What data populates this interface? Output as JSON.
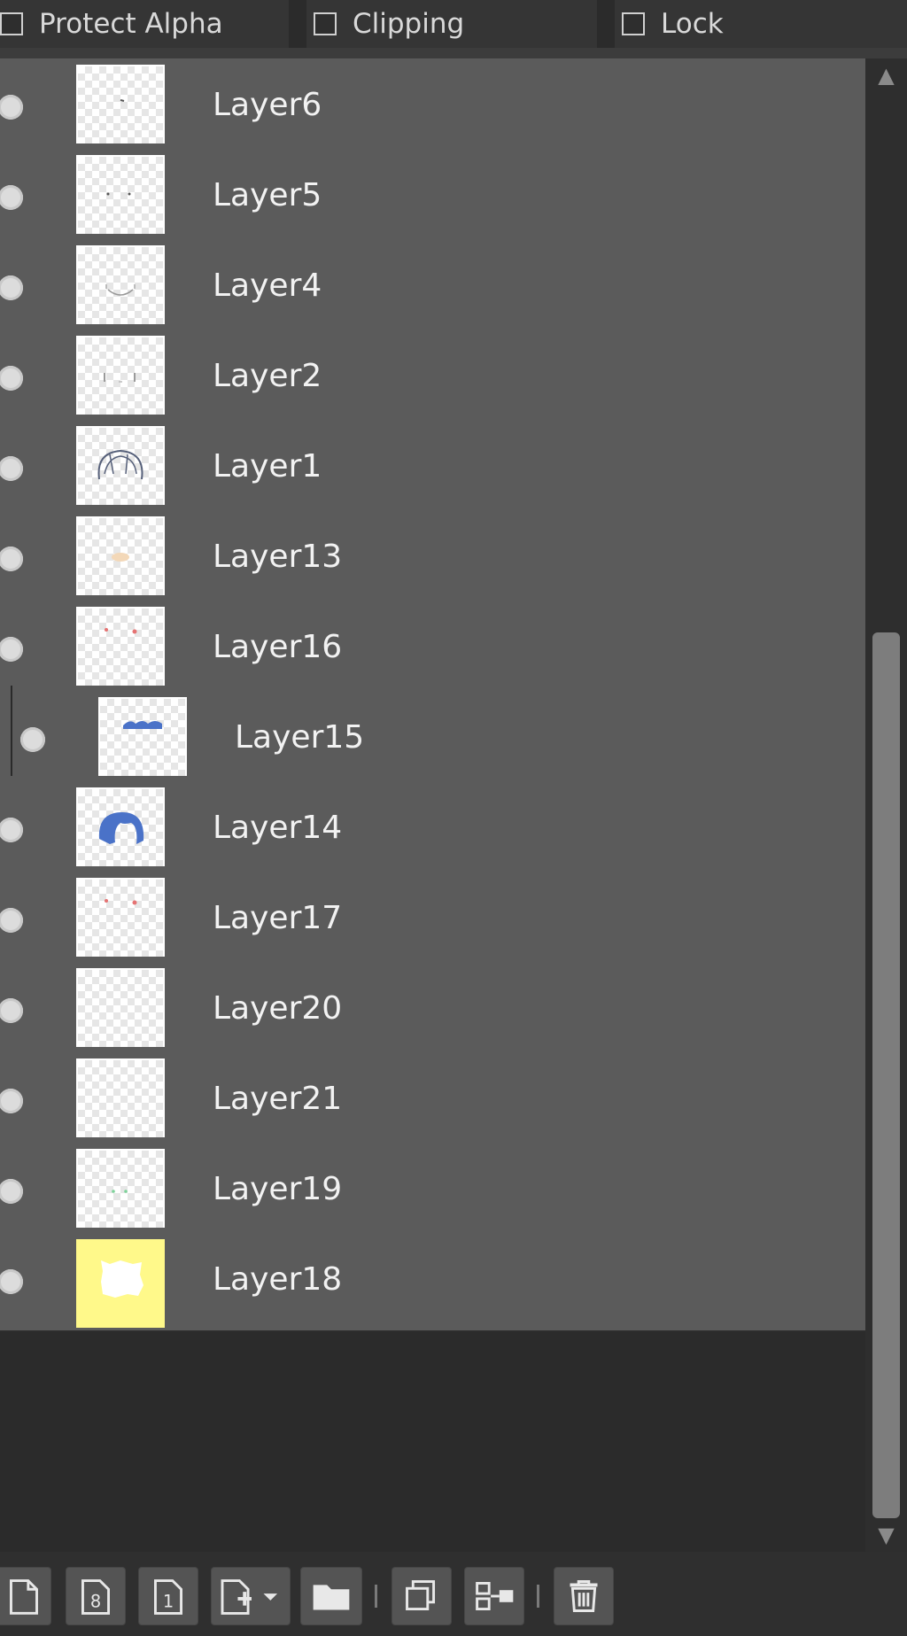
{
  "options": {
    "protect_alpha": "Protect Alpha",
    "clipping": "Clipping",
    "lock": "Lock"
  },
  "layers": [
    {
      "name": "Layer6",
      "thumb": "tiny-mark"
    },
    {
      "name": "Layer5",
      "thumb": "two-dots"
    },
    {
      "name": "Layer4",
      "thumb": "mouth-curve"
    },
    {
      "name": "Layer2",
      "thumb": "face-lines"
    },
    {
      "name": "Layer1",
      "thumb": "hair-sketch"
    },
    {
      "name": "Layer13",
      "thumb": "skin-blob"
    },
    {
      "name": "Layer16",
      "thumb": "red-dots"
    },
    {
      "name": "Layer15",
      "thumb": "blue-band",
      "clipped": true
    },
    {
      "name": "Layer14",
      "thumb": "blue-hair"
    },
    {
      "name": "Layer17",
      "thumb": "red-dots"
    },
    {
      "name": "Layer20",
      "thumb": "empty"
    },
    {
      "name": "Layer21",
      "thumb": "empty"
    },
    {
      "name": "Layer19",
      "thumb": "green-dots"
    },
    {
      "name": "Layer18",
      "thumb": "yellow-fill"
    }
  ],
  "scrollbar": {
    "position_fraction": 1.0
  },
  "toolbar": [
    "new-layer-icon",
    "new-8bit-layer-icon",
    "new-1bit-layer-icon",
    "add-special-layer-icon",
    "new-folder-icon",
    "duplicate-layer-icon",
    "merge-down-icon",
    "delete-layer-icon"
  ],
  "colors": {
    "row_bg": "#5b5b5b",
    "panel_bg": "#2b2b2b",
    "hair_blue": "#4a72c8",
    "highlight_yellow": "#fff98a"
  }
}
